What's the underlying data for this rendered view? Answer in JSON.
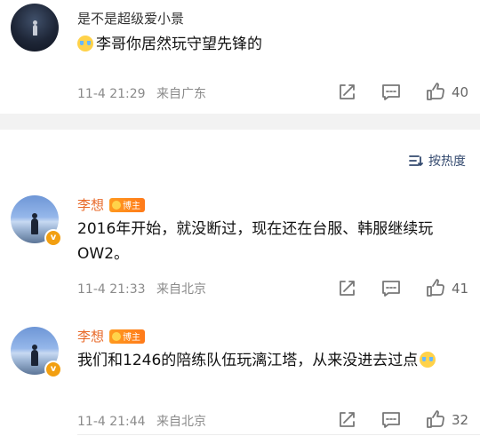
{
  "top_post": {
    "username": "是不是超级爱小景",
    "content": "李哥你居然玩守望先锋的",
    "date": "11-4 21:29",
    "location": "来自广东",
    "likes": "40"
  },
  "sort": {
    "label": "按热度"
  },
  "comments": [
    {
      "username": "李想",
      "tag": "博主",
      "content": "2016年开始，就没断过，现在还在台服、韩服继续玩OW2。",
      "date": "11-4 21:33",
      "location": "来自北京",
      "likes": "41"
    },
    {
      "username": "李想",
      "tag": "博主",
      "content": "我们和1246的陪练队伍玩漓江塔，从来没进去过点",
      "date": "11-4 21:44",
      "location": "来自北京",
      "likes": "32"
    }
  ]
}
